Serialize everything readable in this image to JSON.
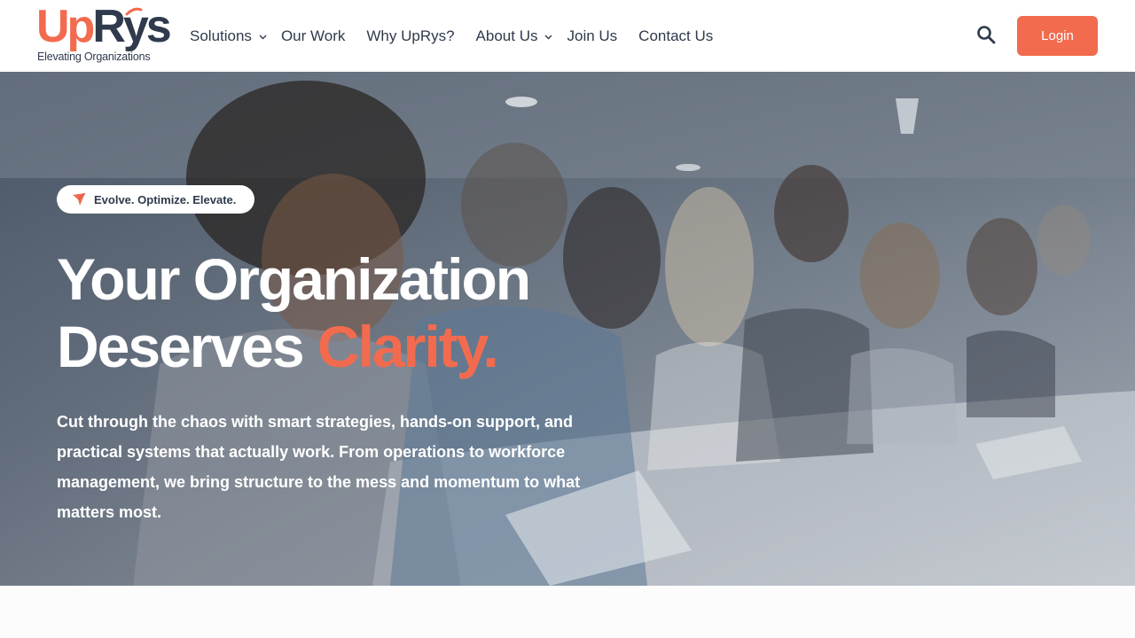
{
  "brand": {
    "logo_primary": "Up",
    "logo_secondary": "Rys",
    "logo_tagline": "Elevating Organizations",
    "accent_color": "#f26b4e",
    "navy_color": "#2f3a4c"
  },
  "nav": {
    "items": [
      {
        "label": "Solutions",
        "has_dropdown": true
      },
      {
        "label": "Our Work",
        "has_dropdown": false
      },
      {
        "label": "Why UpRys?",
        "has_dropdown": false
      },
      {
        "label": "About Us",
        "has_dropdown": true
      },
      {
        "label": "Join Us",
        "has_dropdown": false
      },
      {
        "label": "Contact Us",
        "has_dropdown": false
      }
    ],
    "search_icon": "search-icon",
    "login_label": "Login"
  },
  "hero": {
    "badge_icon": "paper-plane-icon",
    "badge_text": "Evolve. Optimize. Elevate.",
    "headline_line1": "Your Organization",
    "headline_line2_prefix": "Deserves ",
    "headline_accent": "Clarity.",
    "description": "Cut through the chaos with smart strategies, hands-on support, and practical systems that actually work. From operations to workforce management, we bring structure to the mess and momentum to what matters most."
  }
}
